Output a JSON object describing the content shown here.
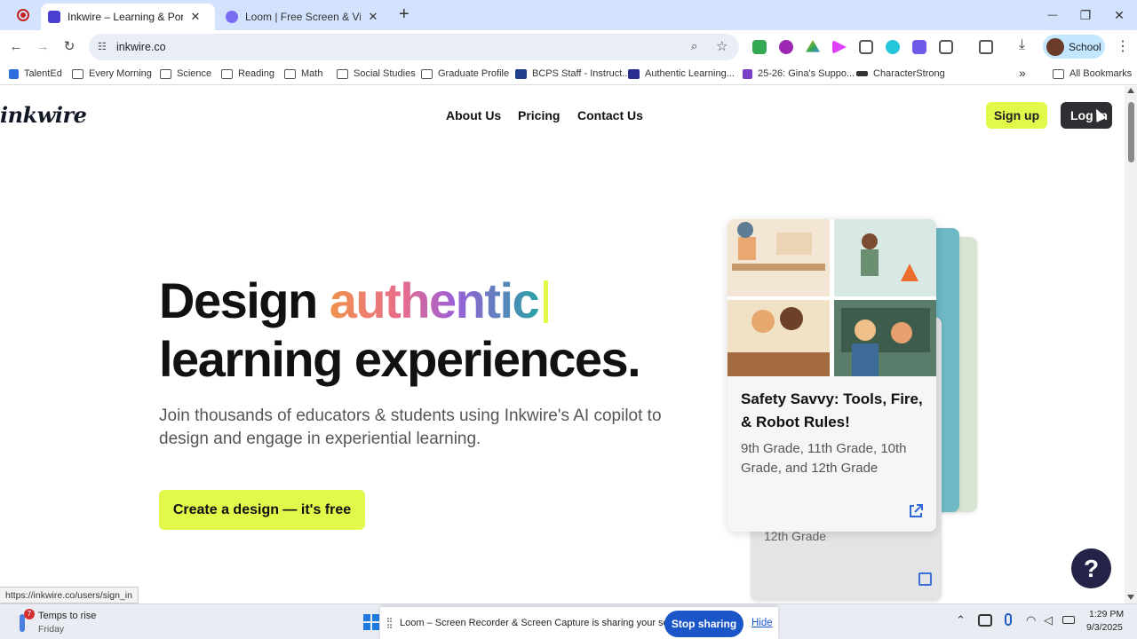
{
  "browser": {
    "tabs": [
      {
        "title": "Inkwire – Learning & Portfolio P",
        "active": true
      },
      {
        "title": "Loom | Free Screen & Video Re",
        "active": false
      }
    ],
    "new_tab": "+",
    "window_controls": {
      "minimize": "—",
      "maximize": "❐",
      "close": "✕"
    },
    "url": "inkwire.co",
    "profile_name": "School",
    "bookmarks": [
      "TalentEd",
      "Every Morning",
      "Science",
      "Reading",
      "Math",
      "Social Studies",
      "Graduate Profile",
      "BCPS Staff - Instruct...",
      "Authentic Learning...",
      "25-26: Gina's Suppo...",
      "CharacterStrong"
    ],
    "bookmarks_overflow": "»",
    "all_bookmarks": "All Bookmarks",
    "status_url": "https://inkwire.co/users/sign_in"
  },
  "site": {
    "logo": "inkwire",
    "nav": [
      "About Us",
      "Pricing",
      "Contact Us"
    ],
    "signup": "Sign up",
    "login": "Log In",
    "hero_word1": "Design",
    "hero_word2": "authentic",
    "hero_line2": "learning experiences.",
    "subtitle": "Join thousands of educators & students using Inkwire's AI copilot to design and engage in experiential learning.",
    "cta": "Create a design — it's free",
    "card": {
      "title": "Safety Savvy: Tools, Fire, & Robot Rules!",
      "grades": "9th Grade, 11th Grade, 10th Grade, and 12th Grade"
    },
    "back_card_grade": "12th Grade",
    "help": "?"
  },
  "taskbar": {
    "weather_title": "Temps to rise",
    "weather_sub": "Friday",
    "weather_badge": "7",
    "share_text": "Loom – Screen Recorder & Screen Capture is sharing your screen.",
    "stop_sharing": "Stop sharing",
    "hide": "Hide",
    "time": "1:29 PM",
    "date": "9/3/2025"
  },
  "colors": {
    "accent_lime": "#e2f84a",
    "dark_button": "#2f2f33",
    "help_bubble": "#232447"
  }
}
